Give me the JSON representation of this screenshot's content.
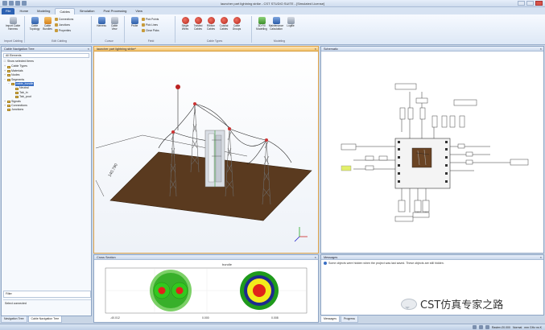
{
  "window": {
    "title": "launcher part lightning strike - CST STUDIO SUITE - [Simulated License]"
  },
  "tabs": [
    {
      "label": "File"
    },
    {
      "label": "Home"
    },
    {
      "label": "Modeling"
    },
    {
      "label": "Cables"
    },
    {
      "label": "Simulation"
    },
    {
      "label": "Post Processing"
    },
    {
      "label": "View"
    }
  ],
  "ribbon": {
    "groups": {
      "import_cabling": "Import Cabling",
      "edit_cabling": "Edit Cabling",
      "cursor": "Cursor",
      "field": "Field",
      "cable_types": "Cable Types",
      "modeling": "Modeling"
    },
    "buttons": {
      "import_cable_harness": "Import Cable Harness",
      "cable_topology": "Cable Topology",
      "cable_bundles": "Cable Bundles",
      "connections": "Connections",
      "junctions": "Junctions",
      "properties": "Properties",
      "harness": "Harness",
      "cable_view": "Cable View",
      "probe": "Probe",
      "pick_points": "Pick Points",
      "pick_lines": "Pick Lines",
      "clear_picks": "Clear Picks",
      "single_wires": "Single Wires",
      "twisted_cables": "Twisted Cables",
      "ribbon_cables": "Ribbon Cables",
      "coaxial_cables": "Coaxial Cables",
      "cable_groups": "Cable Groups",
      "3d_fill": "3D Fill Modelling",
      "maintenance_calculation": "Maintenance Calculation",
      "logfile": "Logfile"
    }
  },
  "navtree": {
    "header": "Cable Navigation Tree",
    "filter_label": "All Elements",
    "show_selected": "Show selected items",
    "items": [
      {
        "label": "Cable Types",
        "level": 0
      },
      {
        "label": "Materials",
        "level": 0
      },
      {
        "label": "Nodes",
        "level": 0
      },
      {
        "label": "Segments",
        "level": 0
      },
      {
        "label": "cable_bundle",
        "level": 1
      },
      {
        "label": "Neutral",
        "level": 2
      },
      {
        "label": "Tab_in",
        "level": 2
      },
      {
        "label": "Tab_pout",
        "level": 2
      },
      {
        "label": "Signals",
        "level": 0
      },
      {
        "label": "Connections",
        "level": 0
      },
      {
        "label": "Junctions",
        "level": 0
      }
    ],
    "filter_placeholder": "Filter",
    "select_connected": "Select connected"
  },
  "bottom_tabs": {
    "navigation": "Navigation Tree",
    "cable": "Cable Navigation Tree"
  },
  "view3d": {
    "tab_label": "launcher part lightning strike*",
    "dimension_label": "140.790"
  },
  "schematic": {
    "header": "Schematic"
  },
  "cross_section": {
    "header": "Cross Section",
    "plot_title": "bundle",
    "axis_ticks": [
      "-40.012",
      "0.000",
      "0.008"
    ]
  },
  "messages": {
    "header": "Messages",
    "text": "Some objects were hidden when the project was last saved. These objects are still hidden.",
    "tabs": [
      "Messages",
      "Progress"
    ]
  },
  "statusbar": {
    "units": "Raster=20.000",
    "mode": "Normal",
    "units2": "mm GHz ns K"
  },
  "watermark": {
    "text": "CST仿真专家之路"
  },
  "colors": {
    "accent": "#2d62b3",
    "ground": "#5a3a1f",
    "tower": "#7a7a7a",
    "cable": "#222222"
  }
}
